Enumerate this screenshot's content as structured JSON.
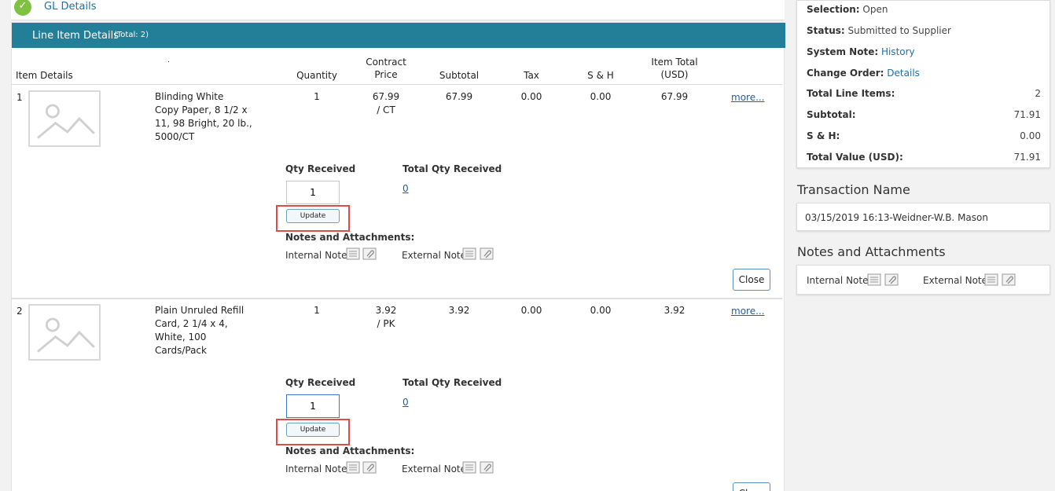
{
  "gl": {
    "title": "GL Details"
  },
  "panel": {
    "title": "Line Item Details",
    "total": "(Total: 2)"
  },
  "columns": {
    "item_details": "Item Details",
    "quantity": "Quantity",
    "contract_price_1": "Contract",
    "contract_price_2": "Price",
    "subtotal": "Subtotal",
    "tax": "Tax",
    "sh": "S & H",
    "item_total_1": "Item Total",
    "item_total_2": "(USD)",
    "dot": "."
  },
  "items": [
    {
      "num": "1",
      "desc_lines": [
        "Blinding White",
        "Copy Paper, 8 1/2 x",
        "11, 98 Bright, 20 lb.,",
        "5000/CT"
      ],
      "quantity": "1",
      "price": "67.99",
      "unit": "/ CT",
      "subtotal": "67.99",
      "tax": "0.00",
      "sh": "0.00",
      "total": "67.99",
      "more": "more...",
      "qty_received_label": "Qty Received",
      "qty_received_value": "1",
      "total_qty_label": "Total Qty Received",
      "total_qty_value": "0",
      "update": "Update",
      "notes_label": "Notes and Attachments:",
      "internal_note": "Internal Note",
      "external_note": "External Note",
      "close": "Close"
    },
    {
      "num": "2",
      "desc_lines": [
        "Plain Unruled Refill",
        "Card, 2 1/4 x 4,",
        "White, 100",
        "Cards/Pack"
      ],
      "quantity": "1",
      "price": "3.92",
      "unit": "/ PK",
      "subtotal": "3.92",
      "tax": "0.00",
      "sh": "0.00",
      "total": "3.92",
      "more": "more...",
      "qty_received_label": "Qty Received",
      "qty_received_value": "1",
      "total_qty_label": "Total Qty Received",
      "total_qty_value": "0",
      "update": "Update",
      "notes_label": "Notes and Attachments:",
      "internal_note": "Internal Note",
      "external_note": "External Note",
      "close": "Close"
    }
  ],
  "summary": {
    "selection_k": "Selection:",
    "selection_v": "Open",
    "status_k": "Status:",
    "status_v": "Submitted to Supplier",
    "sysnote_k": "System Note:",
    "sysnote_v": "History",
    "change_k": "Change Order:",
    "change_v": "Details",
    "lines_k": "Total Line Items:",
    "lines_v": "2",
    "subtotal_k": "Subtotal:",
    "subtotal_v": "71.91",
    "sh_k": "S & H:",
    "sh_v": "0.00",
    "total_k": "Total Value (USD):",
    "total_v": "71.91"
  },
  "transaction": {
    "title": "Transaction Name",
    "value": "03/15/2019 16:13-Weidner-W.B. Mason"
  },
  "notes": {
    "title": "Notes and Attachments",
    "internal": "Internal Note",
    "external": "External Note"
  },
  "colors": {
    "header": "#237e98",
    "link": "#1f6fa9",
    "highlight": "#e24a4a",
    "check": "#7fc241"
  }
}
